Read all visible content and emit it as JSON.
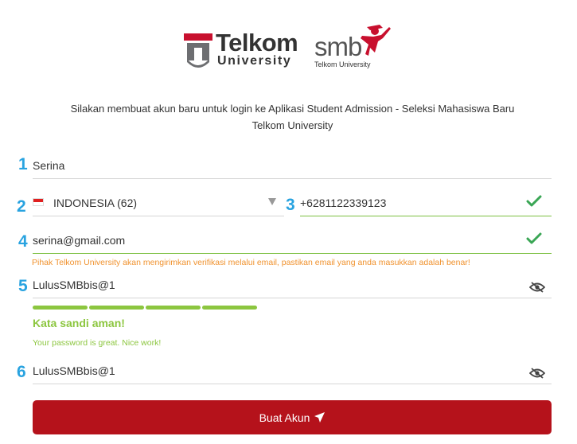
{
  "logos": {
    "telkom_word": "Telkom",
    "telkom_sub": "University",
    "smb_word": "smb",
    "smb_sub": "Telkom University"
  },
  "intro": {
    "line1": "Silakan membuat akun baru untuk login ke Aplikasi Student Admission - Seleksi Mahasiswa Baru",
    "line2": "Telkom University"
  },
  "form": {
    "markers": [
      "1",
      "2",
      "3",
      "4",
      "5",
      "6"
    ],
    "name_value": "Serina",
    "country_value": "INDONESIA (62)",
    "phone_value": "+6281122339123",
    "email_value": "serina@gmail.com",
    "email_hint": "Pihak Telkom University akan mengirimkan verifikasi melalui email, pastikan email yang anda masukkan adalah benar!",
    "password_value": "LulusSMBbis@1",
    "strength_label": "Kata sandi aman!",
    "strength_message": "Your password is great. Nice work!",
    "strength_fraction": 1.0,
    "confirm_value": "LulusSMBbis@1",
    "submit_label": "Buat Akun"
  },
  "colors": {
    "accent_red": "#b5121b",
    "marker_blue": "#29a3e0",
    "valid_green": "#7cc142",
    "hint_orange": "#f0922e"
  }
}
